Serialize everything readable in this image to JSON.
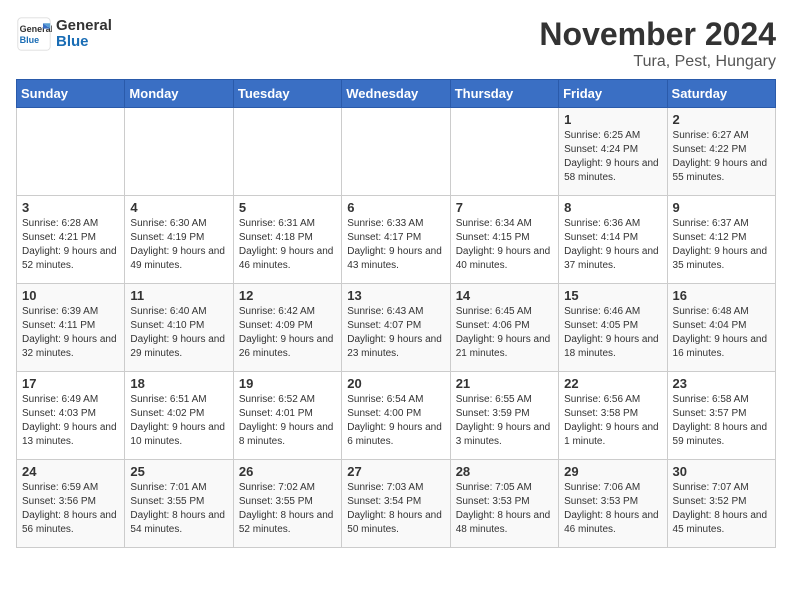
{
  "header": {
    "logo_general": "General",
    "logo_blue": "Blue",
    "month_title": "November 2024",
    "location": "Tura, Pest, Hungary"
  },
  "days_of_week": [
    "Sunday",
    "Monday",
    "Tuesday",
    "Wednesday",
    "Thursday",
    "Friday",
    "Saturday"
  ],
  "weeks": [
    [
      {
        "day": "",
        "info": ""
      },
      {
        "day": "",
        "info": ""
      },
      {
        "day": "",
        "info": ""
      },
      {
        "day": "",
        "info": ""
      },
      {
        "day": "",
        "info": ""
      },
      {
        "day": "1",
        "info": "Sunrise: 6:25 AM\nSunset: 4:24 PM\nDaylight: 9 hours and 58 minutes."
      },
      {
        "day": "2",
        "info": "Sunrise: 6:27 AM\nSunset: 4:22 PM\nDaylight: 9 hours and 55 minutes."
      }
    ],
    [
      {
        "day": "3",
        "info": "Sunrise: 6:28 AM\nSunset: 4:21 PM\nDaylight: 9 hours and 52 minutes."
      },
      {
        "day": "4",
        "info": "Sunrise: 6:30 AM\nSunset: 4:19 PM\nDaylight: 9 hours and 49 minutes."
      },
      {
        "day": "5",
        "info": "Sunrise: 6:31 AM\nSunset: 4:18 PM\nDaylight: 9 hours and 46 minutes."
      },
      {
        "day": "6",
        "info": "Sunrise: 6:33 AM\nSunset: 4:17 PM\nDaylight: 9 hours and 43 minutes."
      },
      {
        "day": "7",
        "info": "Sunrise: 6:34 AM\nSunset: 4:15 PM\nDaylight: 9 hours and 40 minutes."
      },
      {
        "day": "8",
        "info": "Sunrise: 6:36 AM\nSunset: 4:14 PM\nDaylight: 9 hours and 37 minutes."
      },
      {
        "day": "9",
        "info": "Sunrise: 6:37 AM\nSunset: 4:12 PM\nDaylight: 9 hours and 35 minutes."
      }
    ],
    [
      {
        "day": "10",
        "info": "Sunrise: 6:39 AM\nSunset: 4:11 PM\nDaylight: 9 hours and 32 minutes."
      },
      {
        "day": "11",
        "info": "Sunrise: 6:40 AM\nSunset: 4:10 PM\nDaylight: 9 hours and 29 minutes."
      },
      {
        "day": "12",
        "info": "Sunrise: 6:42 AM\nSunset: 4:09 PM\nDaylight: 9 hours and 26 minutes."
      },
      {
        "day": "13",
        "info": "Sunrise: 6:43 AM\nSunset: 4:07 PM\nDaylight: 9 hours and 23 minutes."
      },
      {
        "day": "14",
        "info": "Sunrise: 6:45 AM\nSunset: 4:06 PM\nDaylight: 9 hours and 21 minutes."
      },
      {
        "day": "15",
        "info": "Sunrise: 6:46 AM\nSunset: 4:05 PM\nDaylight: 9 hours and 18 minutes."
      },
      {
        "day": "16",
        "info": "Sunrise: 6:48 AM\nSunset: 4:04 PM\nDaylight: 9 hours and 16 minutes."
      }
    ],
    [
      {
        "day": "17",
        "info": "Sunrise: 6:49 AM\nSunset: 4:03 PM\nDaylight: 9 hours and 13 minutes."
      },
      {
        "day": "18",
        "info": "Sunrise: 6:51 AM\nSunset: 4:02 PM\nDaylight: 9 hours and 10 minutes."
      },
      {
        "day": "19",
        "info": "Sunrise: 6:52 AM\nSunset: 4:01 PM\nDaylight: 9 hours and 8 minutes."
      },
      {
        "day": "20",
        "info": "Sunrise: 6:54 AM\nSunset: 4:00 PM\nDaylight: 9 hours and 6 minutes."
      },
      {
        "day": "21",
        "info": "Sunrise: 6:55 AM\nSunset: 3:59 PM\nDaylight: 9 hours and 3 minutes."
      },
      {
        "day": "22",
        "info": "Sunrise: 6:56 AM\nSunset: 3:58 PM\nDaylight: 9 hours and 1 minute."
      },
      {
        "day": "23",
        "info": "Sunrise: 6:58 AM\nSunset: 3:57 PM\nDaylight: 8 hours and 59 minutes."
      }
    ],
    [
      {
        "day": "24",
        "info": "Sunrise: 6:59 AM\nSunset: 3:56 PM\nDaylight: 8 hours and 56 minutes."
      },
      {
        "day": "25",
        "info": "Sunrise: 7:01 AM\nSunset: 3:55 PM\nDaylight: 8 hours and 54 minutes."
      },
      {
        "day": "26",
        "info": "Sunrise: 7:02 AM\nSunset: 3:55 PM\nDaylight: 8 hours and 52 minutes."
      },
      {
        "day": "27",
        "info": "Sunrise: 7:03 AM\nSunset: 3:54 PM\nDaylight: 8 hours and 50 minutes."
      },
      {
        "day": "28",
        "info": "Sunrise: 7:05 AM\nSunset: 3:53 PM\nDaylight: 8 hours and 48 minutes."
      },
      {
        "day": "29",
        "info": "Sunrise: 7:06 AM\nSunset: 3:53 PM\nDaylight: 8 hours and 46 minutes."
      },
      {
        "day": "30",
        "info": "Sunrise: 7:07 AM\nSunset: 3:52 PM\nDaylight: 8 hours and 45 minutes."
      }
    ]
  ]
}
